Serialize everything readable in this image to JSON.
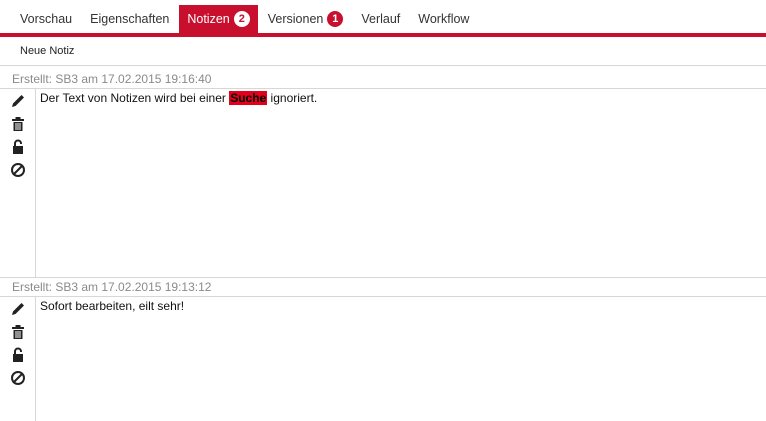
{
  "tabs": [
    {
      "label": "Vorschau"
    },
    {
      "label": "Eigenschaften"
    },
    {
      "label": "Notizen",
      "badge": "2"
    },
    {
      "label": "Versionen",
      "badge": "1"
    },
    {
      "label": "Verlauf"
    },
    {
      "label": "Workflow"
    }
  ],
  "toolbar": {
    "new_note_label": "Neue Notiz"
  },
  "notes": [
    {
      "header": "Erstellt: SB3 am 17.02.2015 19:16:40",
      "text_before": "Der Text von Notizen wird bei einer ",
      "highlight": "Suche",
      "text_after": " ignoriert."
    },
    {
      "header": "Erstellt: SB3 am 17.02.2015 19:13:12",
      "text": "Sofort bearbeiten, eilt sehr!"
    }
  ],
  "icons": [
    "pencil-icon",
    "trash-icon",
    "lock-icon",
    "block-icon"
  ],
  "colors": {
    "accent": "#c8102e",
    "highlight": "#e2001a",
    "meta_text": "#8a8a8a"
  }
}
